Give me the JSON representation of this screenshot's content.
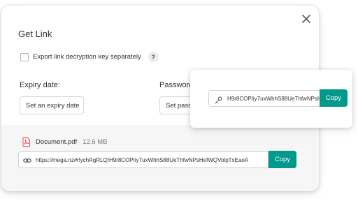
{
  "dialog": {
    "title": "Get Link",
    "export_key_label": "Export link decryption key separately",
    "help_label": "?",
    "expiry_label": "Expiry date:",
    "expiry_button": "Set an expiry date",
    "password_label": "Password",
    "password_button": "Set password"
  },
  "file": {
    "icon": "pdf-icon",
    "name": "Document.pdf",
    "size": "12.6 MB",
    "link": "https://mega.nz/#!ychRgRLQ!H9r8COPIiy7uxWhhS88UeThfwNPsHefWQVolpTxEaoA",
    "copy_label": "Copy"
  },
  "key_popover": {
    "key": "H9r8COPIiy7uxWhhS88UeThfwNPsHefWQVolpTxEaoA",
    "copy_label": "Copy"
  },
  "colors": {
    "accent": "#00998c",
    "pdf_red": "#e0383e"
  }
}
